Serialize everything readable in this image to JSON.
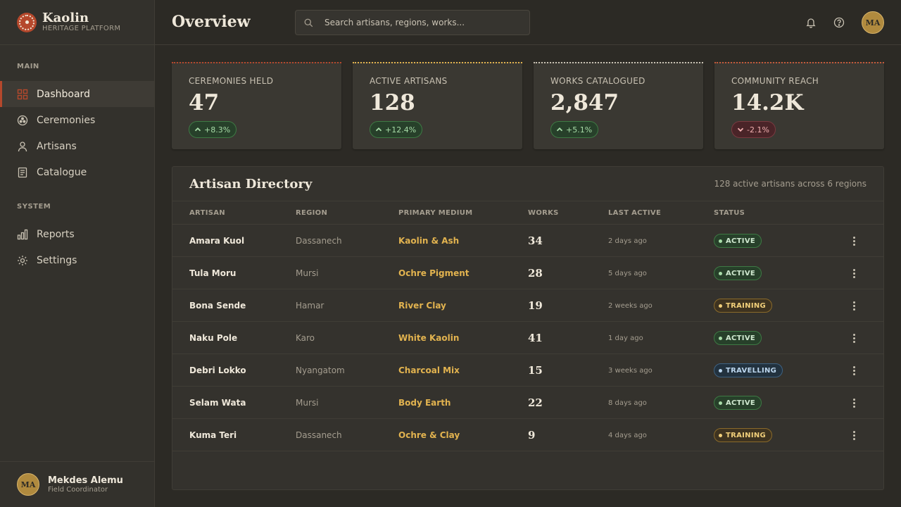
{
  "brand": {
    "name": "Kaolin",
    "subtitle": "HERITAGE PLATFORM"
  },
  "nav": {
    "main_label": "MAIN",
    "system_label": "SYSTEM",
    "items": [
      {
        "label": "Dashboard",
        "icon": "grid-icon",
        "active": true
      },
      {
        "label": "Ceremonies",
        "icon": "ceremony-icon",
        "active": false
      },
      {
        "label": "Artisans",
        "icon": "user-icon",
        "active": false
      },
      {
        "label": "Catalogue",
        "icon": "document-icon",
        "active": false
      },
      {
        "label": "Reports",
        "icon": "bar-chart-icon",
        "active": false
      },
      {
        "label": "Settings",
        "icon": "gear-icon",
        "active": false
      }
    ]
  },
  "user": {
    "initials": "MA",
    "name": "Mekdes Alemu",
    "role": "Field Coordinator"
  },
  "header": {
    "title": "Overview",
    "search_placeholder": "Search artisans, regions, works..."
  },
  "colors": {
    "accent": "#b5482c",
    "gold": "#e2b34f",
    "positive": "#3e7a44",
    "negative": "#7a3a40"
  },
  "stats": [
    {
      "label": "CEREMONIES HELD",
      "value": "47",
      "change": "+8.3%",
      "trend": "up",
      "accent": "#b5482c"
    },
    {
      "label": "ACTIVE ARTISANS",
      "value": "128",
      "change": "+12.4%",
      "trend": "up",
      "accent": "#e2b34f"
    },
    {
      "label": "WORKS CATALOGUED",
      "value": "2,847",
      "change": "+5.1%",
      "trend": "up",
      "accent": "#c9c2b3"
    },
    {
      "label": "COMMUNITY REACH",
      "value": "14.2K",
      "change": "-2.1%",
      "trend": "down",
      "accent": "#c45a3a"
    }
  ],
  "directory": {
    "title": "Artisan Directory",
    "summary": "128 active artisans across 6 regions",
    "columns": [
      "ARTISAN",
      "REGION",
      "PRIMARY MEDIUM",
      "WORKS",
      "LAST ACTIVE",
      "STATUS"
    ],
    "rows": [
      {
        "name": "Amara Kuol",
        "region": "Dassanech",
        "medium": "Kaolin & Ash",
        "works": "34",
        "last": "2 days ago",
        "status": "ACTIVE",
        "kind": "active"
      },
      {
        "name": "Tula Moru",
        "region": "Mursi",
        "medium": "Ochre Pigment",
        "works": "28",
        "last": "5 days ago",
        "status": "ACTIVE",
        "kind": "active"
      },
      {
        "name": "Bona Sende",
        "region": "Hamar",
        "medium": "River Clay",
        "works": "19",
        "last": "2 weeks ago",
        "status": "TRAINING",
        "kind": "training"
      },
      {
        "name": "Naku Pole",
        "region": "Karo",
        "medium": "White Kaolin",
        "works": "41",
        "last": "1 day ago",
        "status": "ACTIVE",
        "kind": "active"
      },
      {
        "name": "Debri Lokko",
        "region": "Nyangatom",
        "medium": "Charcoal Mix",
        "works": "15",
        "last": "3 weeks ago",
        "status": "TRAVELLING",
        "kind": "travelling"
      },
      {
        "name": "Selam Wata",
        "region": "Mursi",
        "medium": "Body Earth",
        "works": "22",
        "last": "8 days ago",
        "status": "ACTIVE",
        "kind": "active"
      },
      {
        "name": "Kuma Teri",
        "region": "Dassanech",
        "medium": "Ochre & Clay",
        "works": "9",
        "last": "4 days ago",
        "status": "TRAINING",
        "kind": "training"
      }
    ]
  }
}
